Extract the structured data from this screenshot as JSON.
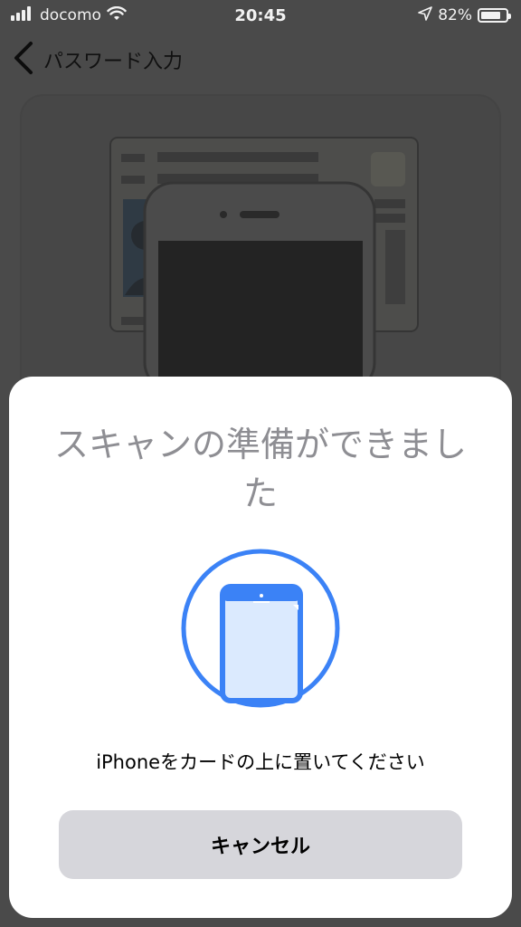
{
  "status_bar": {
    "carrier": "docomo",
    "time": "20:45",
    "battery_percent": "82%",
    "battery_level": 0.82
  },
  "nav": {
    "title": "パスワード入力"
  },
  "sheet": {
    "title": "スキャンの準備ができました",
    "instruction": "iPhoneをカードの上に置いてください",
    "cancel_label": "キャンセル"
  },
  "colors": {
    "accent": "#3b82f6",
    "sheet_bg": "#ffffff",
    "overlay_bg": "#4a4a4a",
    "button_bg": "#d6d6db",
    "title_gray": "#8e8e93"
  },
  "icons": {
    "signal": "signal-bars-icon",
    "wifi": "wifi-icon",
    "location": "location-arrow-icon",
    "battery": "battery-icon",
    "back": "chevron-left-icon",
    "scan": "phone-scan-icon"
  }
}
